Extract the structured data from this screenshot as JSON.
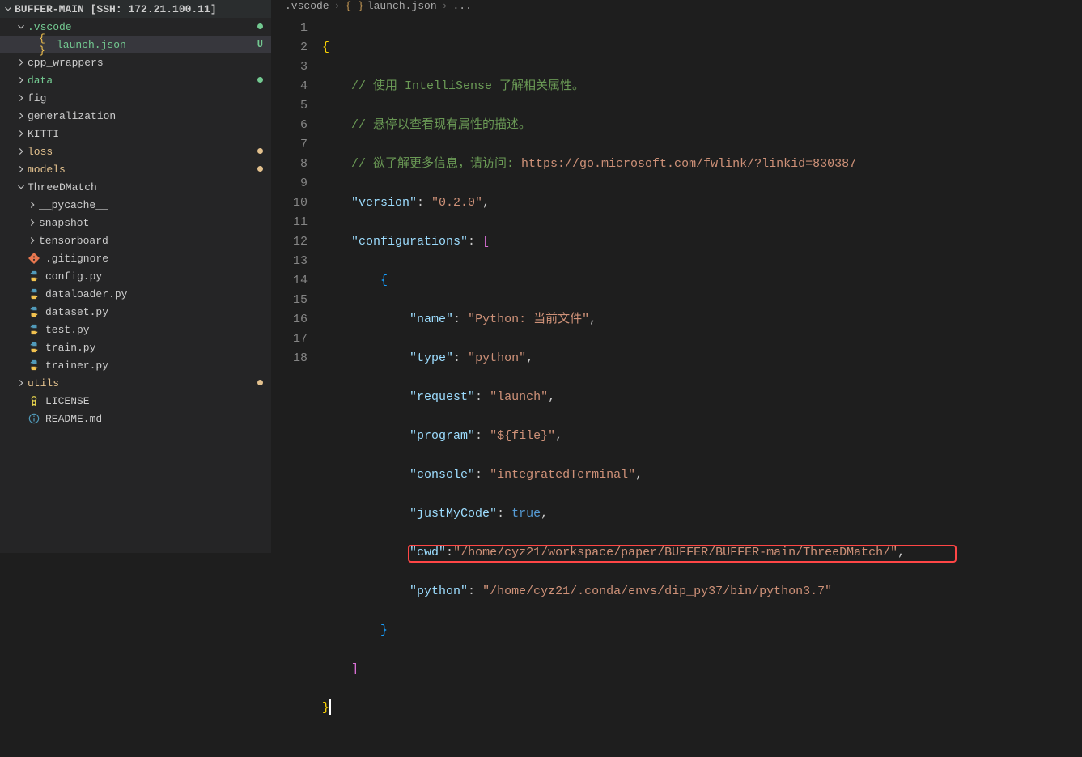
{
  "explorer": {
    "root_label": "BUFFER-MAIN [SSH: 172.21.100.11]",
    "items": [
      {
        "label": ".vscode",
        "kind": "folder",
        "open": true,
        "indent": 1,
        "color": "green",
        "badge": "dot-green"
      },
      {
        "label": "launch.json",
        "kind": "json",
        "open": false,
        "indent": 2,
        "color": "green",
        "badge": "U",
        "selected": true
      },
      {
        "label": "cpp_wrappers",
        "kind": "folder",
        "open": false,
        "indent": 1
      },
      {
        "label": "data",
        "kind": "folder",
        "open": false,
        "indent": 1,
        "color": "green",
        "badge": "dot-green"
      },
      {
        "label": "fig",
        "kind": "folder",
        "open": false,
        "indent": 1
      },
      {
        "label": "generalization",
        "kind": "folder",
        "open": false,
        "indent": 1
      },
      {
        "label": "KITTI",
        "kind": "folder",
        "open": false,
        "indent": 1
      },
      {
        "label": "loss",
        "kind": "folder",
        "open": false,
        "indent": 1,
        "color": "olive",
        "badge": "dot-olive"
      },
      {
        "label": "models",
        "kind": "folder",
        "open": false,
        "indent": 1,
        "color": "olive",
        "badge": "dot-olive"
      },
      {
        "label": "ThreeDMatch",
        "kind": "folder",
        "open": true,
        "indent": 1
      },
      {
        "label": "__pycache__",
        "kind": "folder",
        "open": false,
        "indent": 2
      },
      {
        "label": "snapshot",
        "kind": "folder",
        "open": false,
        "indent": 2
      },
      {
        "label": "tensorboard",
        "kind": "folder",
        "open": false,
        "indent": 2
      },
      {
        "label": ".gitignore",
        "kind": "git",
        "open": false,
        "indent": 1
      },
      {
        "label": "config.py",
        "kind": "py",
        "open": false,
        "indent": 1
      },
      {
        "label": "dataloader.py",
        "kind": "py",
        "open": false,
        "indent": 1
      },
      {
        "label": "dataset.py",
        "kind": "py",
        "open": false,
        "indent": 1
      },
      {
        "label": "test.py",
        "kind": "py",
        "open": false,
        "indent": 1
      },
      {
        "label": "train.py",
        "kind": "py",
        "open": false,
        "indent": 1
      },
      {
        "label": "trainer.py",
        "kind": "py",
        "open": false,
        "indent": 1
      },
      {
        "label": "utils",
        "kind": "folder",
        "open": false,
        "indent": 1,
        "color": "olive",
        "badge": "dot-olive"
      },
      {
        "label": "LICENSE",
        "kind": "license",
        "open": false,
        "indent": 1
      },
      {
        "label": "README.md",
        "kind": "info",
        "open": false,
        "indent": 1
      }
    ]
  },
  "breadcrumbs": {
    "p1": ".vscode",
    "p2": "launch.json",
    "p3": "..."
  },
  "code": {
    "line_count": 18,
    "comment1": "// 使用 IntelliSense 了解相关属性。",
    "comment2": "// 悬停以查看现有属性的描述。",
    "comment3a": "// 欲了解更多信息，请访问: ",
    "comment3b": "https://go.microsoft.com/fwlink/?linkid=830387",
    "version_key": "\"version\"",
    "version_val": "\"0.2.0\"",
    "config_key": "\"configurations\"",
    "name_key": "\"name\"",
    "name_val": "\"Python: 当前文件\"",
    "type_key": "\"type\"",
    "type_val": "\"python\"",
    "request_key": "\"request\"",
    "request_val": "\"launch\"",
    "program_key": "\"program\"",
    "program_val": "\"${file}\"",
    "console_key": "\"console\"",
    "console_val": "\"integratedTerminal\"",
    "justmycode_key": "\"justMyCode\"",
    "justmycode_val": "true",
    "cwd_key": "\"cwd\"",
    "cwd_val": "\"/home/cyz21/workspace/paper/BUFFER/BUFFER-main/ThreeDMatch/\"",
    "python_key": "\"python\"",
    "python_val": "\"/home/cyz21/.conda/envs/dip_py37/bin/python3.7\""
  }
}
